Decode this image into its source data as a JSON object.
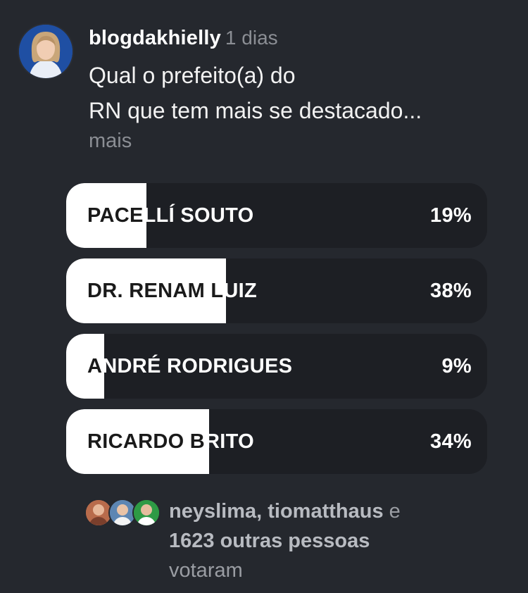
{
  "post": {
    "username": "blogdakhielly",
    "time": "1 dias",
    "question_line1": "Qual o prefeito(a) do",
    "question_line2": "RN que tem mais se destacado...",
    "more_label": "mais"
  },
  "poll": {
    "options": [
      {
        "label": "PACELLÍ SOUTO",
        "percent_text": "19%",
        "percent": 19
      },
      {
        "label": "DR. RENAM LUIZ",
        "percent_text": "38%",
        "percent": 38
      },
      {
        "label": "ANDRÉ RODRIGUES",
        "percent_text": "9%",
        "percent": 9
      },
      {
        "label": "RICARDO BRITO",
        "percent_text": "34%",
        "percent": 34
      }
    ]
  },
  "voters": {
    "names": "neyslima, tiomatthaus",
    "connector": "e",
    "others": "1623 outras pessoas",
    "voted": "votaram",
    "avatar_icons": [
      "voter-avatar-icon",
      "voter-avatar-icon",
      "voter-avatar-icon"
    ]
  },
  "colors": {
    "background": "#25282e",
    "bar_track": "#1d1f24",
    "bar_fill": "#ffffff",
    "muted_text": "#8b8e94"
  }
}
